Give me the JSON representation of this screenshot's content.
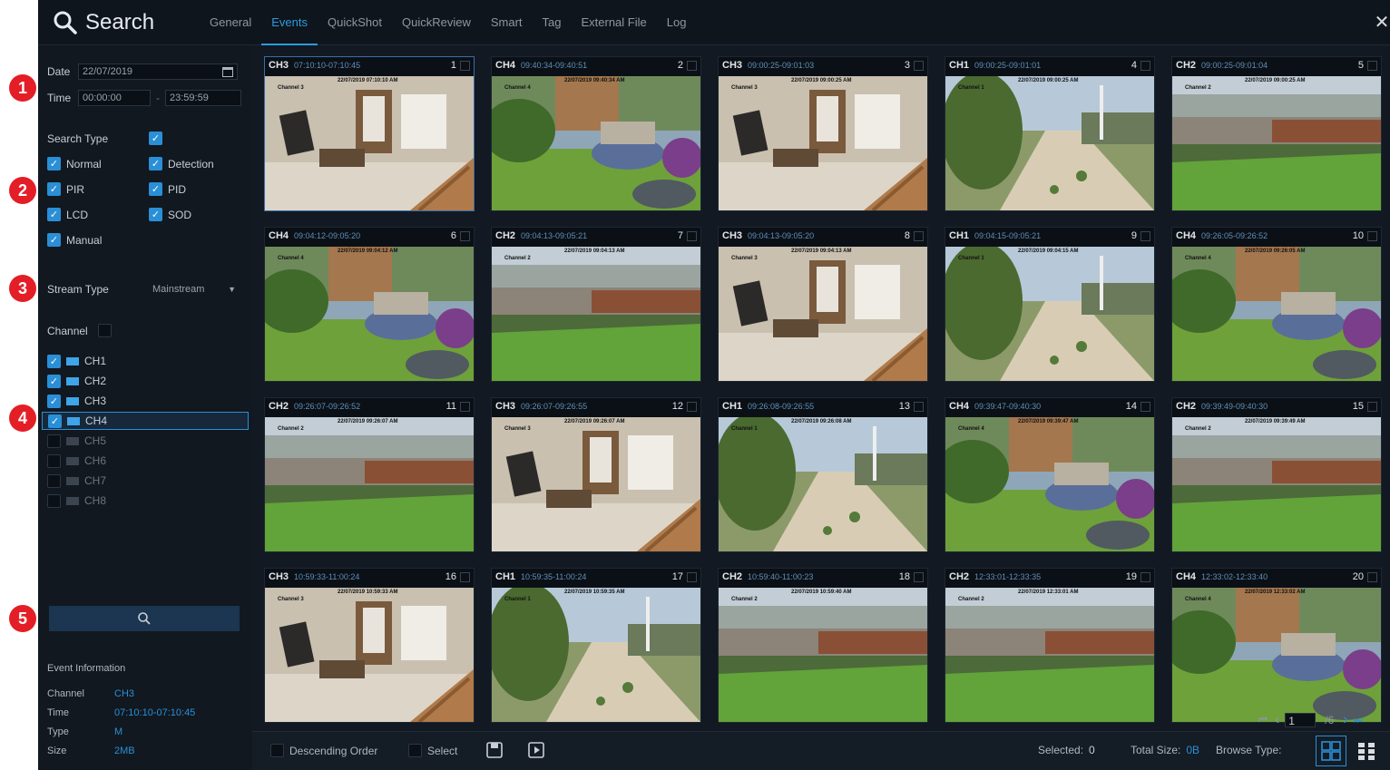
{
  "header": {
    "title": "Search",
    "tabs": [
      "General",
      "Events",
      "QuickShot",
      "QuickReview",
      "Smart",
      "Tag",
      "External File",
      "Log"
    ],
    "active_tab": "Events",
    "close_glyph": "✕"
  },
  "filters": {
    "date_label": "Date",
    "date_value": "22/07/2019",
    "time_label": "Time",
    "time_from": "00:00:00",
    "time_sep": "-",
    "time_to": "23:59:59",
    "search_type_label": "Search Type",
    "search_types": [
      {
        "label": "Normal",
        "checked": true
      },
      {
        "label": "Detection",
        "checked": true
      },
      {
        "label": "PIR",
        "checked": true
      },
      {
        "label": "PID",
        "checked": true
      },
      {
        "label": "LCD",
        "checked": true
      },
      {
        "label": "SOD",
        "checked": true
      },
      {
        "label": "Manual",
        "checked": true
      }
    ],
    "stream_type_label": "Stream Type",
    "stream_type_value": "Mainstream",
    "channel_label": "Channel",
    "channels": [
      {
        "label": "CH1",
        "checked": true
      },
      {
        "label": "CH2",
        "checked": true
      },
      {
        "label": "CH3",
        "checked": true
      },
      {
        "label": "CH4",
        "checked": true
      },
      {
        "label": "CH5",
        "checked": false
      },
      {
        "label": "CH6",
        "checked": false
      },
      {
        "label": "CH7",
        "checked": false
      },
      {
        "label": "CH8",
        "checked": false
      }
    ],
    "highlighted_channel": "CH4"
  },
  "event_info": {
    "heading": "Event Information",
    "channel_label": "Channel",
    "channel_value": "CH3",
    "time_label": "Time",
    "time_value": "07:10:10-07:10:45",
    "type_label": "Type",
    "type_value": "M",
    "size_label": "Size",
    "size_value": "2MB"
  },
  "callouts": [
    "1",
    "2",
    "3",
    "4",
    "5"
  ],
  "results": [
    {
      "num": "1",
      "ch": "CH3",
      "time": "07:10:10-07:10:45",
      "overlay_ch": "Channel 3",
      "overlay_ts": "22/07/2019 07:10:10 AM",
      "scene": "indoor"
    },
    {
      "num": "2",
      "ch": "CH4",
      "time": "09:40:34-09:40:51",
      "overlay_ch": "Channel 4",
      "overlay_ts": "22/07/2019 09:40:34 AM",
      "scene": "yard"
    },
    {
      "num": "3",
      "ch": "CH3",
      "time": "09:00:25-09:01:03",
      "overlay_ch": "Channel 3",
      "overlay_ts": "22/07/2019 09:00:25 AM",
      "scene": "indoor"
    },
    {
      "num": "4",
      "ch": "CH1",
      "time": "09:00:25-09:01:01",
      "overlay_ch": "Channel 1",
      "overlay_ts": "22/07/2019 09:00:25 AM",
      "scene": "path"
    },
    {
      "num": "5",
      "ch": "CH2",
      "time": "09:00:25-09:01:04",
      "overlay_ch": "Channel 2",
      "overlay_ts": "22/07/2019 09:00:25 AM",
      "scene": "fence"
    },
    {
      "num": "6",
      "ch": "CH4",
      "time": "09:04:12-09:05:20",
      "overlay_ch": "Channel 4",
      "overlay_ts": "22/07/2019 09:04:12 AM",
      "scene": "yard"
    },
    {
      "num": "7",
      "ch": "CH2",
      "time": "09:04:13-09:05:21",
      "overlay_ch": "Channel 2",
      "overlay_ts": "22/07/2019 09:04:13 AM",
      "scene": "fence"
    },
    {
      "num": "8",
      "ch": "CH3",
      "time": "09:04:13-09:05:20",
      "overlay_ch": "Channel 3",
      "overlay_ts": "22/07/2019 09:04:13 AM",
      "scene": "indoor"
    },
    {
      "num": "9",
      "ch": "CH1",
      "time": "09:04:15-09:05:21",
      "overlay_ch": "Channel 1",
      "overlay_ts": "22/07/2019 09:04:15 AM",
      "scene": "path"
    },
    {
      "num": "10",
      "ch": "CH4",
      "time": "09:26:05-09:26:52",
      "overlay_ch": "Channel 4",
      "overlay_ts": "22/07/2019 09:26:05 AM",
      "scene": "yard"
    },
    {
      "num": "11",
      "ch": "CH2",
      "time": "09:26:07-09:26:52",
      "overlay_ch": "Channel 2",
      "overlay_ts": "22/07/2019 09:26:07 AM",
      "scene": "fence"
    },
    {
      "num": "12",
      "ch": "CH3",
      "time": "09:26:07-09:26:55",
      "overlay_ch": "Channel 3",
      "overlay_ts": "22/07/2019 09:26:07 AM",
      "scene": "indoor"
    },
    {
      "num": "13",
      "ch": "CH1",
      "time": "09:26:08-09:26:55",
      "overlay_ch": "Channel 1",
      "overlay_ts": "22/07/2019 09:26:08 AM",
      "scene": "path"
    },
    {
      "num": "14",
      "ch": "CH4",
      "time": "09:39:47-09:40:30",
      "overlay_ch": "Channel 4",
      "overlay_ts": "22/07/2019 09:39:47 AM",
      "scene": "yard"
    },
    {
      "num": "15",
      "ch": "CH2",
      "time": "09:39:49-09:40:30",
      "overlay_ch": "Channel 2",
      "overlay_ts": "22/07/2019 09:39:49 AM",
      "scene": "fence"
    },
    {
      "num": "16",
      "ch": "CH3",
      "time": "10:59:33-11:00:24",
      "overlay_ch": "Channel 3",
      "overlay_ts": "22/07/2019 10:59:33 AM",
      "scene": "indoor"
    },
    {
      "num": "17",
      "ch": "CH1",
      "time": "10:59:35-11:00:24",
      "overlay_ch": "Channel 1",
      "overlay_ts": "22/07/2019 10:59:35 AM",
      "scene": "path"
    },
    {
      "num": "18",
      "ch": "CH2",
      "time": "10:59:40-11:00:23",
      "overlay_ch": "Channel 2",
      "overlay_ts": "22/07/2019 10:59:40 AM",
      "scene": "fence"
    },
    {
      "num": "19",
      "ch": "CH2",
      "time": "12:33:01-12:33:35",
      "overlay_ch": "Channel 2",
      "overlay_ts": "22/07/2019 12:33:01 AM",
      "scene": "fence"
    },
    {
      "num": "20",
      "ch": "CH4",
      "time": "12:33:02-12:33:40",
      "overlay_ch": "Channel 4",
      "overlay_ts": "22/07/2019 12:33:02 AM",
      "scene": "yard"
    }
  ],
  "selected_tile": "1",
  "pagination": {
    "first": "⏮",
    "prev": "‹",
    "page": "1",
    "total": "/6",
    "next": "›",
    "last": "⏭"
  },
  "bottom": {
    "descending_label": "Descending Order",
    "select_label": "Select",
    "selected_label": "Selected:",
    "selected_value": "0",
    "total_size_label": "Total Size:",
    "total_size_value": "0B",
    "browse_type_label": "Browse Type:"
  },
  "colors": {
    "accent": "#2a8fd6",
    "callout": "#e41e26",
    "background": "#121922"
  }
}
